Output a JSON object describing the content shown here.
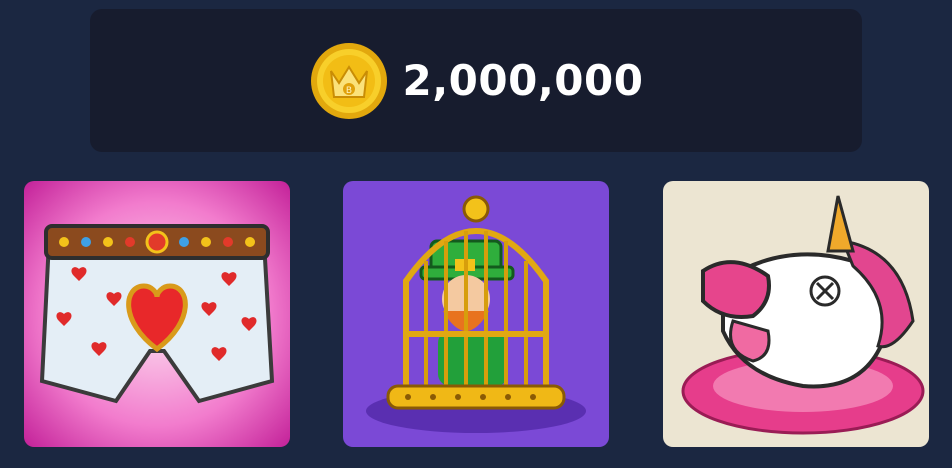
{
  "balance": {
    "amount": "2,000,000",
    "icon": "coin-icon",
    "coin_color": "#f3c21a"
  },
  "items": [
    {
      "icon": "heart-boxers-icon",
      "background": "#e64fbd"
    },
    {
      "icon": "caged-leprechaun-icon",
      "background": "#7a4ad8"
    },
    {
      "icon": "melting-unicorn-icon",
      "background": "#ece6d4"
    }
  ]
}
